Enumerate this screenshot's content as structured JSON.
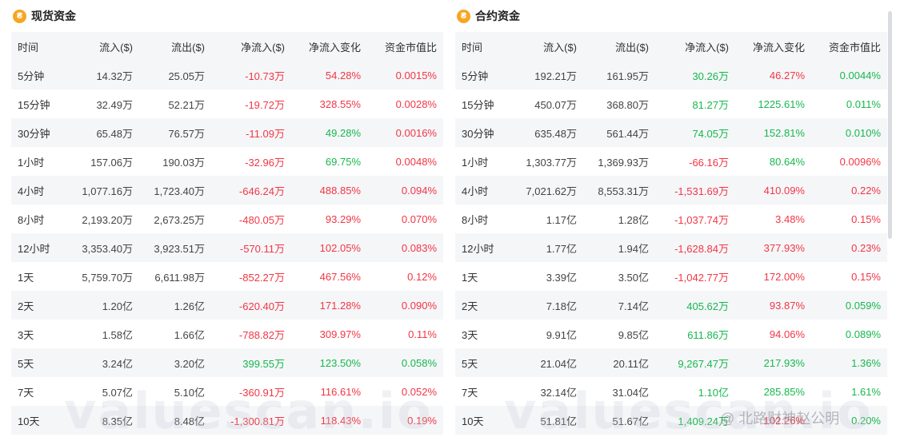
{
  "columns": [
    "时间",
    "流入($)",
    "流出($)",
    "净流入($)",
    "净流入变化",
    "资金市值比"
  ],
  "spot": {
    "title": "现货资金",
    "rows": [
      {
        "time": "5分钟",
        "inflow": "14.32万",
        "outflow": "25.05万",
        "net": "-10.73万",
        "net_color": "neg",
        "change": "54.28%",
        "change_color": "neg",
        "ratio": "0.0015%",
        "ratio_color": "neg"
      },
      {
        "time": "15分钟",
        "inflow": "32.49万",
        "outflow": "52.21万",
        "net": "-19.72万",
        "net_color": "neg",
        "change": "328.55%",
        "change_color": "neg",
        "ratio": "0.0028%",
        "ratio_color": "neg"
      },
      {
        "time": "30分钟",
        "inflow": "65.48万",
        "outflow": "76.57万",
        "net": "-11.09万",
        "net_color": "neg",
        "change": "49.28%",
        "change_color": "pos",
        "ratio": "0.0016%",
        "ratio_color": "neg"
      },
      {
        "time": "1小时",
        "inflow": "157.06万",
        "outflow": "190.03万",
        "net": "-32.96万",
        "net_color": "neg",
        "change": "69.75%",
        "change_color": "pos",
        "ratio": "0.0048%",
        "ratio_color": "neg"
      },
      {
        "time": "4小时",
        "inflow": "1,077.16万",
        "outflow": "1,723.40万",
        "net": "-646.24万",
        "net_color": "neg",
        "change": "488.85%",
        "change_color": "neg",
        "ratio": "0.094%",
        "ratio_color": "neg"
      },
      {
        "time": "8小时",
        "inflow": "2,193.20万",
        "outflow": "2,673.25万",
        "net": "-480.05万",
        "net_color": "neg",
        "change": "93.29%",
        "change_color": "neg",
        "ratio": "0.070%",
        "ratio_color": "neg"
      },
      {
        "time": "12小时",
        "inflow": "3,353.40万",
        "outflow": "3,923.51万",
        "net": "-570.11万",
        "net_color": "neg",
        "change": "102.05%",
        "change_color": "neg",
        "ratio": "0.083%",
        "ratio_color": "neg"
      },
      {
        "time": "1天",
        "inflow": "5,759.70万",
        "outflow": "6,611.98万",
        "net": "-852.27万",
        "net_color": "neg",
        "change": "467.56%",
        "change_color": "neg",
        "ratio": "0.12%",
        "ratio_color": "neg"
      },
      {
        "time": "2天",
        "inflow": "1.20亿",
        "outflow": "1.26亿",
        "net": "-620.40万",
        "net_color": "neg",
        "change": "171.28%",
        "change_color": "neg",
        "ratio": "0.090%",
        "ratio_color": "neg"
      },
      {
        "time": "3天",
        "inflow": "1.58亿",
        "outflow": "1.66亿",
        "net": "-788.82万",
        "net_color": "neg",
        "change": "309.97%",
        "change_color": "neg",
        "ratio": "0.11%",
        "ratio_color": "neg"
      },
      {
        "time": "5天",
        "inflow": "3.24亿",
        "outflow": "3.20亿",
        "net": "399.55万",
        "net_color": "pos",
        "change": "123.50%",
        "change_color": "pos",
        "ratio": "0.058%",
        "ratio_color": "pos"
      },
      {
        "time": "7天",
        "inflow": "5.07亿",
        "outflow": "5.10亿",
        "net": "-360.91万",
        "net_color": "neg",
        "change": "116.61%",
        "change_color": "neg",
        "ratio": "0.052%",
        "ratio_color": "neg"
      },
      {
        "time": "10天",
        "inflow": "8.35亿",
        "outflow": "8.48亿",
        "net": "-1,300.81万",
        "net_color": "neg",
        "change": "118.43%",
        "change_color": "neg",
        "ratio": "0.19%",
        "ratio_color": "neg"
      }
    ]
  },
  "futures": {
    "title": "合约资金",
    "rows": [
      {
        "time": "5分钟",
        "inflow": "192.21万",
        "outflow": "161.95万",
        "net": "30.26万",
        "net_color": "pos",
        "change": "46.27%",
        "change_color": "neg",
        "ratio": "0.0044%",
        "ratio_color": "pos"
      },
      {
        "time": "15分钟",
        "inflow": "450.07万",
        "outflow": "368.80万",
        "net": "81.27万",
        "net_color": "pos",
        "change": "1225.61%",
        "change_color": "pos",
        "ratio": "0.011%",
        "ratio_color": "pos"
      },
      {
        "time": "30分钟",
        "inflow": "635.48万",
        "outflow": "561.44万",
        "net": "74.05万",
        "net_color": "pos",
        "change": "152.81%",
        "change_color": "pos",
        "ratio": "0.010%",
        "ratio_color": "pos"
      },
      {
        "time": "1小时",
        "inflow": "1,303.77万",
        "outflow": "1,369.93万",
        "net": "-66.16万",
        "net_color": "neg",
        "change": "80.64%",
        "change_color": "pos",
        "ratio": "0.0096%",
        "ratio_color": "neg"
      },
      {
        "time": "4小时",
        "inflow": "7,021.62万",
        "outflow": "8,553.31万",
        "net": "-1,531.69万",
        "net_color": "neg",
        "change": "410.09%",
        "change_color": "neg",
        "ratio": "0.22%",
        "ratio_color": "neg"
      },
      {
        "time": "8小时",
        "inflow": "1.17亿",
        "outflow": "1.28亿",
        "net": "-1,037.74万",
        "net_color": "neg",
        "change": "3.48%",
        "change_color": "neg",
        "ratio": "0.15%",
        "ratio_color": "neg"
      },
      {
        "time": "12小时",
        "inflow": "1.77亿",
        "outflow": "1.94亿",
        "net": "-1,628.84万",
        "net_color": "neg",
        "change": "377.93%",
        "change_color": "neg",
        "ratio": "0.23%",
        "ratio_color": "neg"
      },
      {
        "time": "1天",
        "inflow": "3.39亿",
        "outflow": "3.50亿",
        "net": "-1,042.77万",
        "net_color": "neg",
        "change": "172.00%",
        "change_color": "neg",
        "ratio": "0.15%",
        "ratio_color": "neg"
      },
      {
        "time": "2天",
        "inflow": "7.18亿",
        "outflow": "7.14亿",
        "net": "405.62万",
        "net_color": "pos",
        "change": "93.87%",
        "change_color": "neg",
        "ratio": "0.059%",
        "ratio_color": "pos"
      },
      {
        "time": "3天",
        "inflow": "9.91亿",
        "outflow": "9.85亿",
        "net": "611.86万",
        "net_color": "pos",
        "change": "94.06%",
        "change_color": "neg",
        "ratio": "0.089%",
        "ratio_color": "pos"
      },
      {
        "time": "5天",
        "inflow": "21.04亿",
        "outflow": "20.11亿",
        "net": "9,267.47万",
        "net_color": "pos",
        "change": "217.93%",
        "change_color": "pos",
        "ratio": "1.36%",
        "ratio_color": "pos"
      },
      {
        "time": "7天",
        "inflow": "32.14亿",
        "outflow": "31.04亿",
        "net": "1.10亿",
        "net_color": "pos",
        "change": "285.85%",
        "change_color": "pos",
        "ratio": "1.61%",
        "ratio_color": "pos"
      },
      {
        "time": "10天",
        "inflow": "51.81亿",
        "outflow": "51.67亿",
        "net": "1,409.24万",
        "net_color": "pos",
        "change": "102.26%",
        "change_color": "neg",
        "ratio": "0.20%",
        "ratio_color": "pos"
      }
    ]
  },
  "watermark": "valuescan.io",
  "author_watermark": "@ 北路财神赵公明",
  "icons": {
    "panel_icon": "coin-icon"
  },
  "colors": {
    "positive": "#16b84e",
    "negative": "#f23645",
    "icon": "#f5a623"
  }
}
